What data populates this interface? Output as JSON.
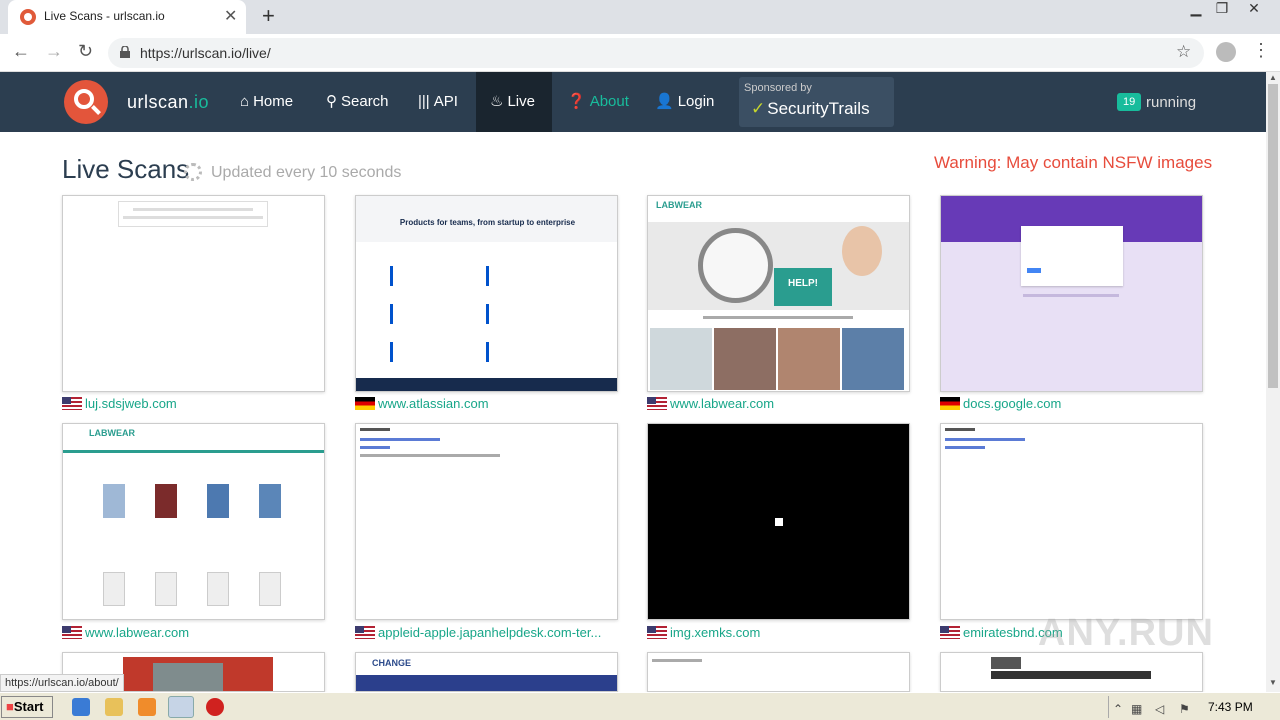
{
  "browser": {
    "tab_title": "Live Scans - urlscan.io",
    "url": "https://urlscan.io/live/",
    "status_url": "https://urlscan.io/about/"
  },
  "nav": {
    "brand": "urlscan",
    "brand_suffix": ".io",
    "items": [
      {
        "label": "Home",
        "icon": "home-icon"
      },
      {
        "label": "Search",
        "icon": "search-icon"
      },
      {
        "label": "API",
        "icon": "barcode-icon"
      },
      {
        "label": "Live",
        "icon": "fire-icon"
      },
      {
        "label": "About",
        "icon": "question-circle-icon"
      },
      {
        "label": "Login",
        "icon": "user-icon"
      }
    ],
    "sponsor_small": "Sponsored by",
    "sponsor_name": "SecurityTrails",
    "running_count": "19",
    "running_label": "running"
  },
  "page": {
    "title": "Live Scans",
    "updated": "Updated every 10 seconds",
    "warning": "Warning: May contain NSFW images"
  },
  "scans": [
    {
      "domain": "luj.sdsjweb.com",
      "flag": "us"
    },
    {
      "domain": "www.atlassian.com",
      "flag": "de"
    },
    {
      "domain": "www.labwear.com",
      "flag": "us"
    },
    {
      "domain": "docs.google.com",
      "flag": "de"
    },
    {
      "domain": "www.labwear.com",
      "flag": "us"
    },
    {
      "domain": "appleid-apple.japanhelpdesk.com-ter...",
      "flag": "us"
    },
    {
      "domain": "img.xemks.com",
      "flag": "us"
    },
    {
      "domain": "emiratesbnd.com",
      "flag": "us"
    }
  ],
  "thumb_text": {
    "atlassian_heading": "Products for teams, from startup to enterprise",
    "labwear_help": "HELP!",
    "labwear_logo": "LABWEAR",
    "change_logo": "CHANGE"
  },
  "taskbar": {
    "start": "Start",
    "time": "7:43 PM"
  },
  "watermark": "ANY.RUN"
}
